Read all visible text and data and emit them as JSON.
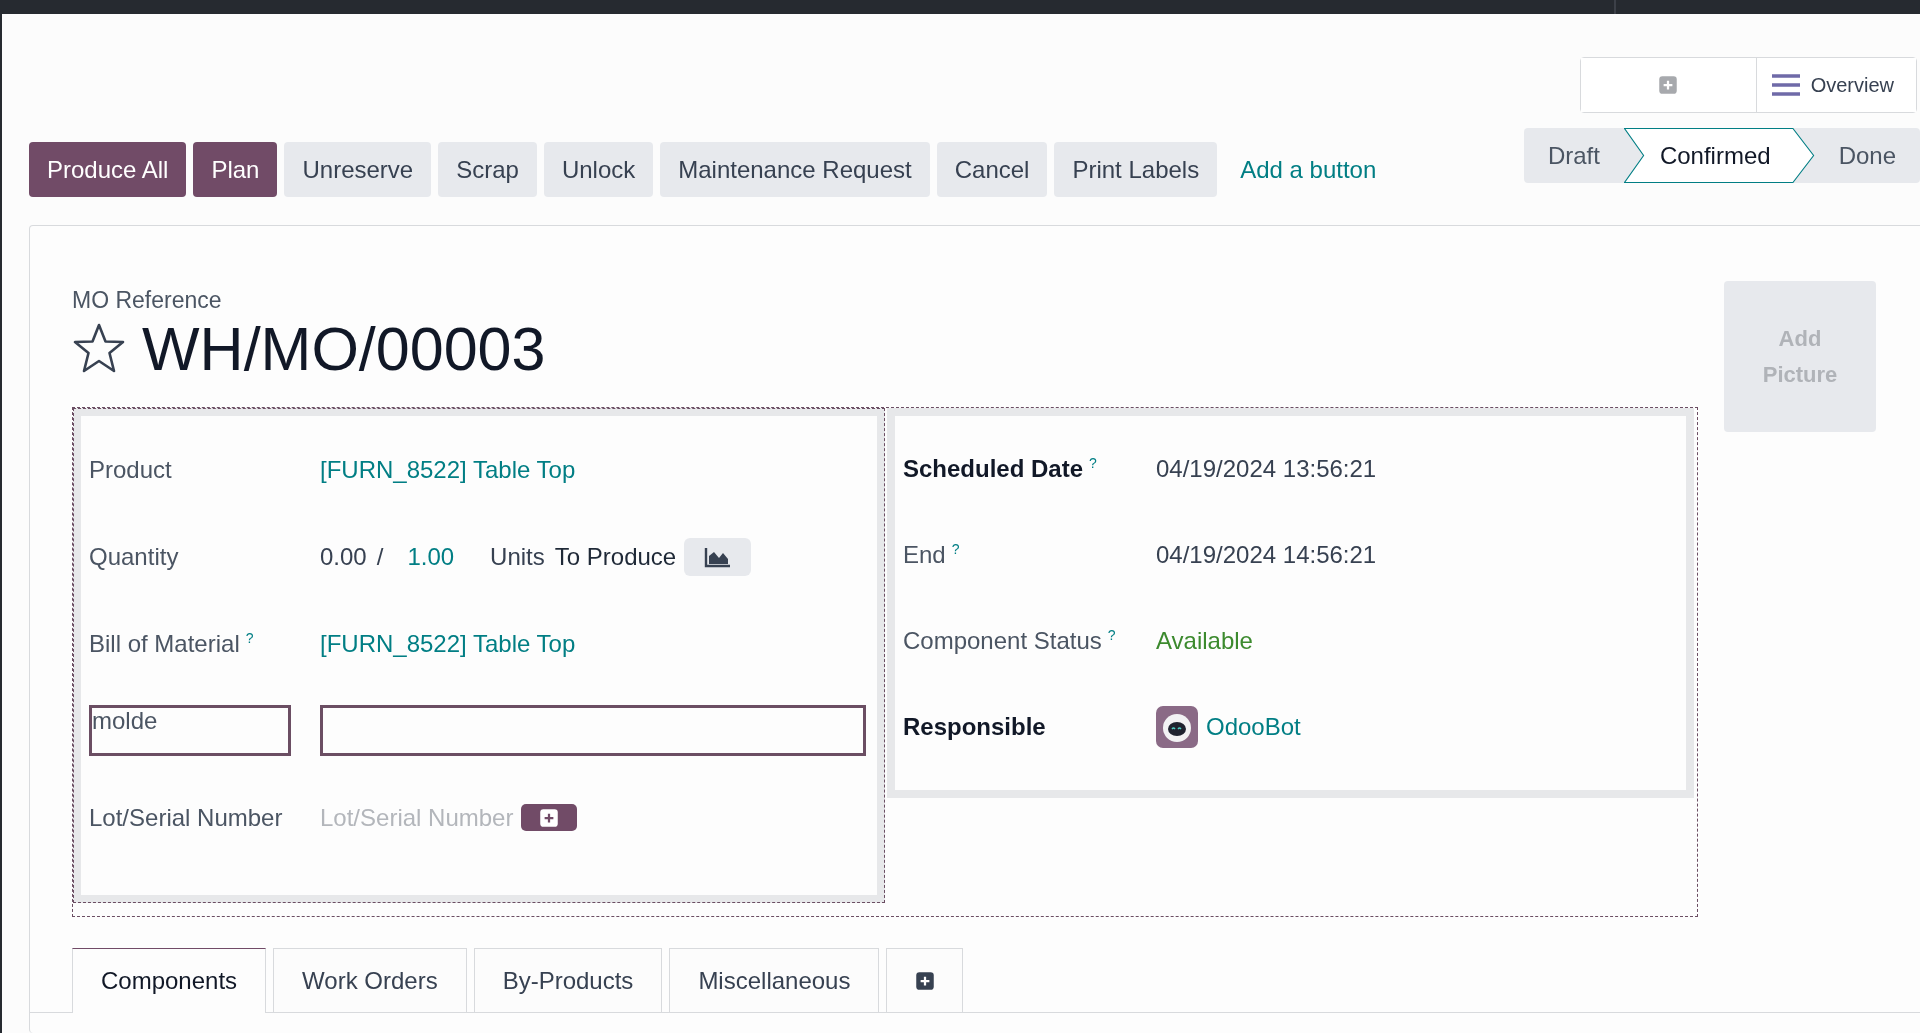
{
  "toolbar": {
    "overview_label": "Overview"
  },
  "actions": [
    {
      "label": "Produce All",
      "kind": "primary"
    },
    {
      "label": "Plan",
      "kind": "primary"
    },
    {
      "label": "Unreserve",
      "kind": "secondary"
    },
    {
      "label": "Scrap",
      "kind": "secondary"
    },
    {
      "label": "Unlock",
      "kind": "secondary"
    },
    {
      "label": "Maintenance Request",
      "kind": "secondary"
    },
    {
      "label": "Cancel",
      "kind": "secondary"
    },
    {
      "label": "Print Labels",
      "kind": "secondary"
    },
    {
      "label": "Add a button",
      "kind": "link"
    }
  ],
  "status_steps": [
    {
      "label": "Draft",
      "selected": false
    },
    {
      "label": "Confirmed",
      "selected": true
    },
    {
      "label": "Done",
      "selected": false
    }
  ],
  "record": {
    "reference_label": "MO Reference",
    "title": "WH/MO/00003",
    "starred": false,
    "add_picture": "Add Picture"
  },
  "left_fields": [
    {
      "kind": "link",
      "label": "Product",
      "required": false,
      "value": "[FURN_8522] Table Top"
    },
    {
      "kind": "quantity",
      "label": "Quantity",
      "required": false,
      "produced": "0.00",
      "separator": "/",
      "target": "1.00",
      "unit": "Units",
      "suffix": "To Produce"
    },
    {
      "kind": "link",
      "label": "Bill of Material",
      "help": "?",
      "required": false,
      "value": "[FURN_8522] Table Top"
    },
    {
      "kind": "custom",
      "label": "molde"
    },
    {
      "kind": "lot",
      "label": "Lot/Serial Number",
      "required": false,
      "placeholder": "Lot/Serial Number"
    }
  ],
  "right_fields": [
    {
      "kind": "text",
      "label": "Scheduled Date",
      "help": "?",
      "required": true,
      "value": "04/19/2024 13:56:21"
    },
    {
      "kind": "text",
      "label": "End",
      "help": "?",
      "required": false,
      "value": "04/19/2024 14:56:21"
    },
    {
      "kind": "status",
      "label": "Component Status",
      "help": "?",
      "required": false,
      "value": "Available"
    },
    {
      "kind": "user",
      "label": "Responsible",
      "required": true,
      "value": "OdooBot"
    }
  ],
  "tabs": [
    {
      "label": "Components",
      "selected": true
    },
    {
      "label": "Work Orders",
      "selected": false
    },
    {
      "label": "By-Products",
      "selected": false
    },
    {
      "label": "Miscellaneous",
      "selected": false
    }
  ]
}
